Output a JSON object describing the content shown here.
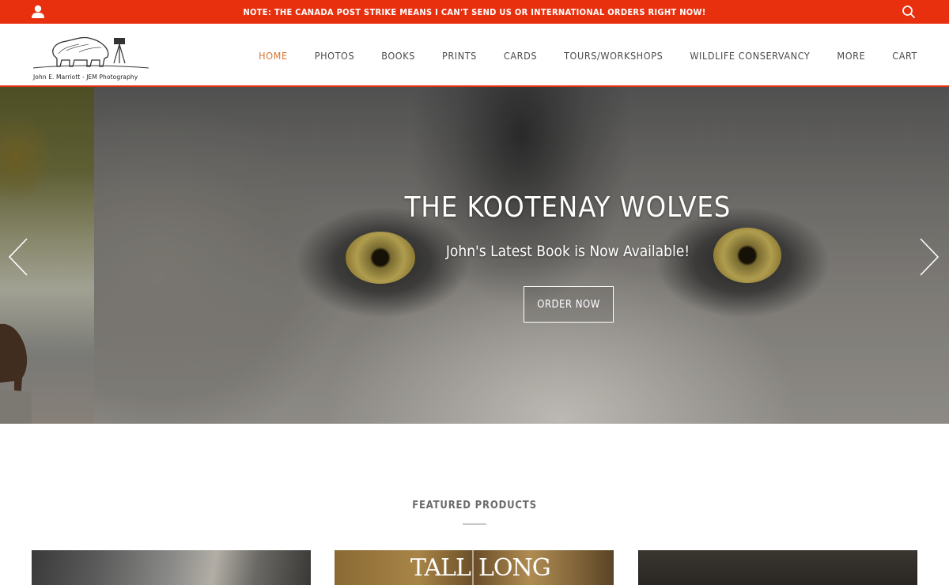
{
  "announcement": {
    "text": "NOTE: THE CANADA POST STRIKE MEANS I CAN'T SEND US OR INTERNATIONAL ORDERS RIGHT NOW!"
  },
  "header": {
    "logo_caption": "John E. Marriott - JEM Photography",
    "nav": [
      {
        "label": "HOME",
        "active": true
      },
      {
        "label": "PHOTOS",
        "active": false
      },
      {
        "label": "BOOKS",
        "active": false
      },
      {
        "label": "PRINTS",
        "active": false
      },
      {
        "label": "CARDS",
        "active": false
      },
      {
        "label": "TOURS/WORKSHOPS",
        "active": false
      },
      {
        "label": "WILDLIFE CONSERVANCY",
        "active": false
      },
      {
        "label": "MORE",
        "active": false
      },
      {
        "label": "CART",
        "active": false
      }
    ]
  },
  "hero": {
    "title": "THE KOOTENAY WOLVES",
    "subtitle": "John's Latest Book is Now Available!",
    "button_label": "ORDER NOW"
  },
  "featured": {
    "title": "FEATURED PRODUCTS",
    "products": [
      {
        "cover_text": ""
      },
      {
        "cover_text_1": "TALL",
        "cover_text_2": "LONG"
      },
      {
        "cover_text": ""
      }
    ]
  },
  "colors": {
    "accent": "#e8300f",
    "nav_active": "#d9742f"
  },
  "icons": {
    "user": "user-icon",
    "search": "search-icon",
    "prev": "chevron-left-icon",
    "next": "chevron-right-icon"
  }
}
